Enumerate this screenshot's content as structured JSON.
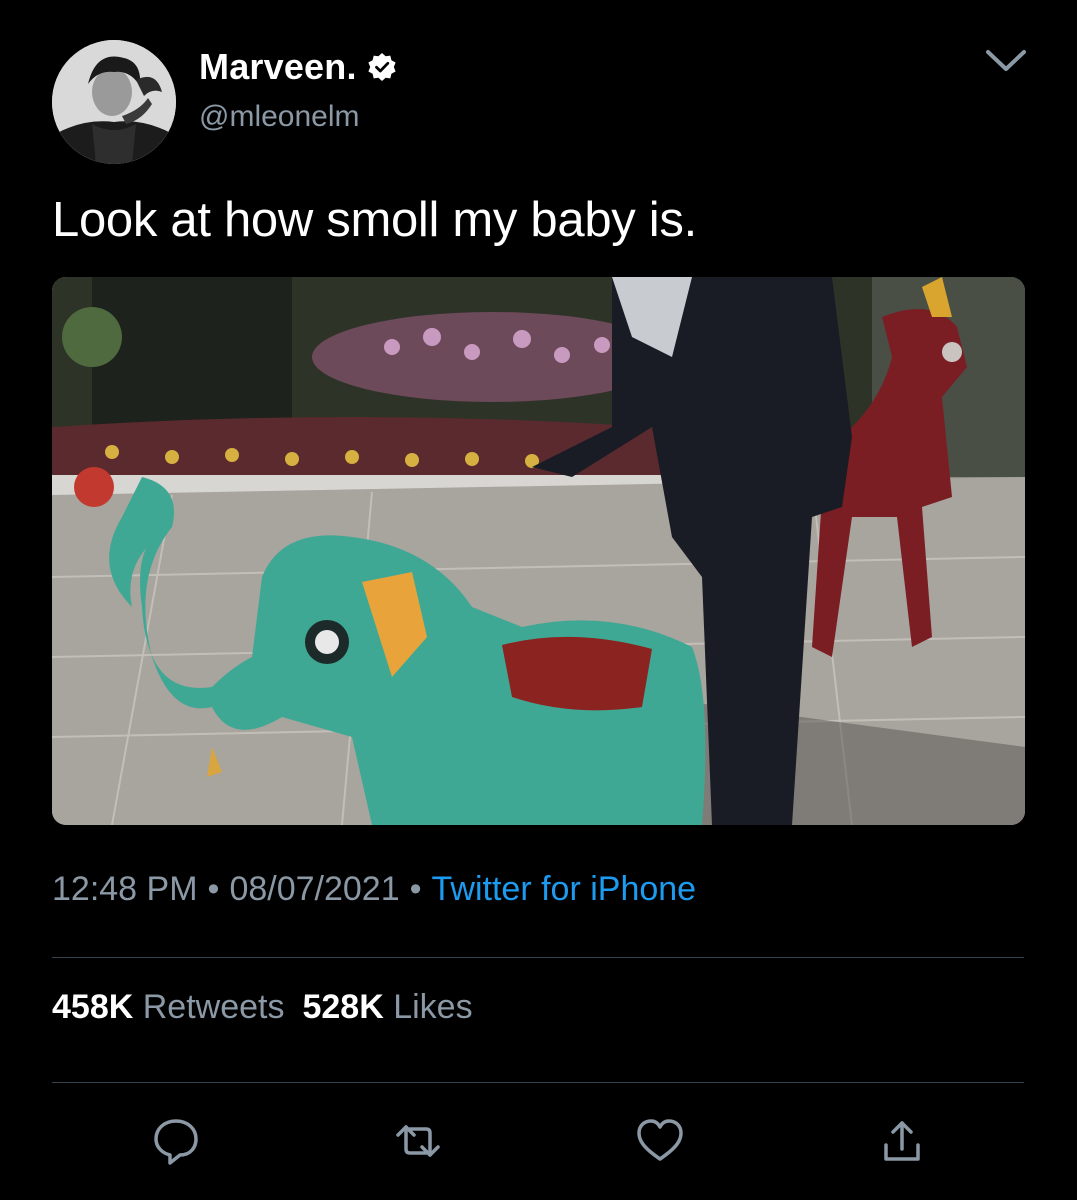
{
  "tweet": {
    "display_name": "Marveen.",
    "handle": "@mleonelm",
    "text": "Look at how smoll my baby is.",
    "time": "12:48 PM",
    "date": "08/07/2021",
    "separator": "•",
    "source": "Twitter for iPhone",
    "verified": true
  },
  "stats": {
    "retweets_count": "458K",
    "retweets_label": "Retweets",
    "likes_count": "528K",
    "likes_label": "Likes"
  },
  "icons": {
    "verified": "verified-badge-icon",
    "menu": "chevron-down-icon",
    "reply": "reply-icon",
    "retweet": "retweet-icon",
    "like": "heart-icon",
    "share": "share-icon"
  },
  "colors": {
    "background": "#000000",
    "text": "#ffffff",
    "secondary_text": "#8b98a5",
    "link": "#1d9bf0",
    "divider": "#38444d"
  }
}
